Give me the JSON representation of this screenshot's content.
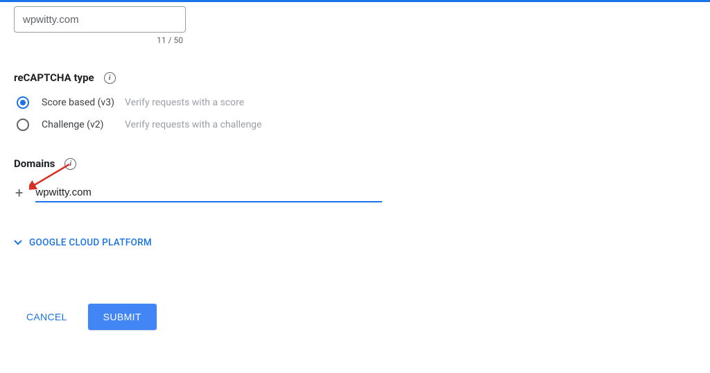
{
  "label": {
    "value": "wpwitty.com",
    "counter": "11 / 50"
  },
  "recaptcha": {
    "title": "reCAPTCHA type",
    "options": [
      {
        "label": "Score based (v3)",
        "desc": "Verify requests with a score",
        "selected": true
      },
      {
        "label": "Challenge (v2)",
        "desc": "Verify requests with a challenge",
        "selected": false
      }
    ]
  },
  "domains": {
    "title": "Domains",
    "input_value": "wpwitty.com"
  },
  "collapsible": {
    "label": "GOOGLE CLOUD PLATFORM"
  },
  "buttons": {
    "cancel": "CANCEL",
    "submit": "SUBMIT"
  }
}
